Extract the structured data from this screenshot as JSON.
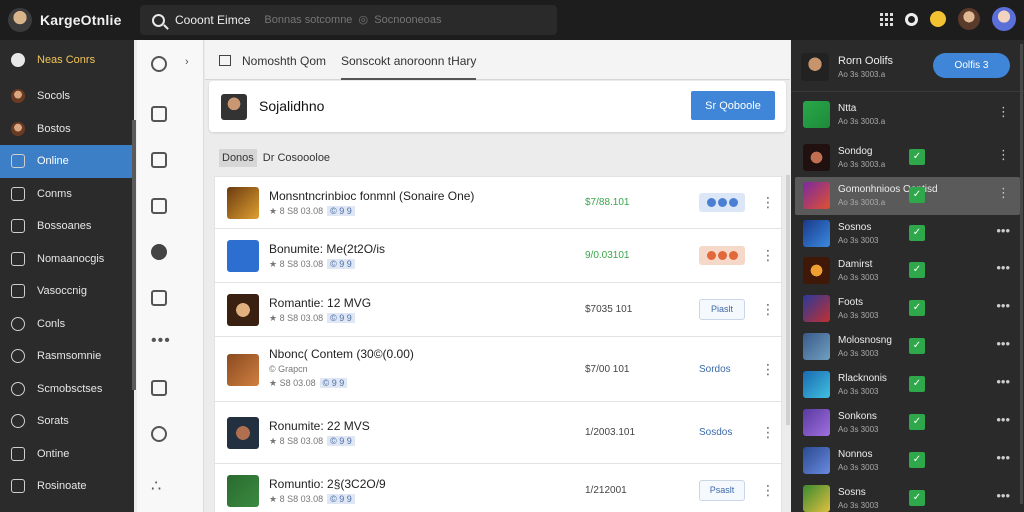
{
  "app": {
    "title": "KargeOtnlie"
  },
  "search": {
    "scope": "Cooont Eimce",
    "placeholder": "Bonnas sotcomne  ◎  Socnooneoas"
  },
  "sidebar": {
    "items": [
      {
        "label": "Neas Conrs",
        "icon": "x-icon"
      },
      {
        "label": "Socols",
        "icon": "avatar-icon"
      },
      {
        "label": "Bostos",
        "icon": "avatar-icon"
      },
      {
        "label": "Online",
        "icon": "monitor-icon",
        "active": true
      },
      {
        "label": "Conms",
        "icon": "square-icon"
      },
      {
        "label": "Bossoanes",
        "icon": "grid-icon"
      },
      {
        "label": "Nomaanocgis",
        "icon": "image-icon"
      },
      {
        "label": "Vasoccnig",
        "icon": "list-icon"
      },
      {
        "label": "Conls",
        "icon": "link-icon"
      },
      {
        "label": "Rasmsomnie",
        "icon": "gear-icon"
      },
      {
        "label": "Scmobsctses",
        "icon": "globe-icon"
      },
      {
        "label": "Sorats",
        "icon": "search-icon"
      },
      {
        "label": "Ontine",
        "icon": "square-icon"
      },
      {
        "label": "Rosinoate",
        "icon": "square-icon"
      }
    ]
  },
  "tabs": [
    {
      "label": "Nomoshth Qom"
    },
    {
      "label": "Sonscokt anoroonn tHary",
      "active": true
    }
  ],
  "profile": {
    "name": "Sojalidhno",
    "button_label": "Sr Qoboole"
  },
  "list": {
    "chip": "Donos",
    "heading": "Dr Cosoooloe",
    "rows": [
      {
        "title": "Monsntncrinbioc fonmnl (Sonaire One)",
        "sub": "★ 8 S8 03.08",
        "badge": "© 9 9",
        "price": "$7/88.101",
        "price_green": true,
        "action_type": "pills",
        "pill_colors": [
          "#4a7fd4",
          "#4a7fd4",
          "#4a7fd4"
        ],
        "pill_bg": "#dbe7f7"
      },
      {
        "title": "Bonumite: Me(2t2O/is",
        "sub": "★ 8 S8 03.08",
        "badge": "© 9 9",
        "price": "9/0.03101",
        "price_green": true,
        "action_type": "pills",
        "pill_colors": [
          "#e0683a",
          "#e0683a",
          "#e0683a"
        ],
        "pill_bg": "#f6d8c8"
      },
      {
        "title": "Romantie: 12 MVG",
        "sub": "★ 8 S8 03.08",
        "badge": "© 9 9",
        "price": "$7035 101",
        "price_green": false,
        "action_type": "button",
        "action": "Piaslt"
      },
      {
        "title": "Nbonc( Contem (30©(0.00)",
        "sub2": "© Grapcn",
        "sub": "★ S8 03.08",
        "badge": "© 9 9",
        "price": "$7/00 101",
        "price_green": false,
        "action_type": "link",
        "action": "Sordos"
      },
      {
        "title": "Ronumite: 22 MVS",
        "sub": "★ 8 S8 03.08",
        "badge": "© 9 9",
        "price": "1/2003.101",
        "price_green": false,
        "action_type": "link",
        "action": "Sosdos"
      },
      {
        "title": "Romuntio: 2§(3C2O/9",
        "sub": "★ 8 S8 03.08",
        "badge": "© 9 9",
        "price": "1/212001",
        "price_green": false,
        "action_type": "button",
        "action": "Psaslt"
      }
    ]
  },
  "right_panel": {
    "header": {
      "title": "Rorn Oolifs",
      "sub": "Ao 3s 3003.a",
      "button_label": "Oolfis  3"
    },
    "items": [
      {
        "title": "Ntta",
        "sub": "Ao 3s 3003.a"
      },
      {
        "title": "Sondog",
        "sub": "Ao 3s 3003.a"
      },
      {
        "title": "Gomonhnioos Oontisd",
        "sub": "Ao 3s 3003.a",
        "active": true
      },
      {
        "title": "Sosnos",
        "sub": "Ao 3s 3003"
      },
      {
        "title": "Damirst",
        "sub": "Ao 3s 3003"
      },
      {
        "title": "Foots",
        "sub": "Ao 3s 3003"
      },
      {
        "title": "Molosnosng",
        "sub": "Ao 3s 3003"
      },
      {
        "title": "Rlacknonis",
        "sub": "Ao 3s 3003"
      },
      {
        "title": "Sonkons",
        "sub": "Ao 3s 3003"
      },
      {
        "title": "Nonnos",
        "sub": "Ao 3s 3003"
      },
      {
        "title": "Sosns",
        "sub": "Ao 3s 3003"
      }
    ]
  },
  "colors": {
    "accent": "#3f86d8",
    "active_side": "#3d7fc6",
    "green": "#2ea84a"
  }
}
